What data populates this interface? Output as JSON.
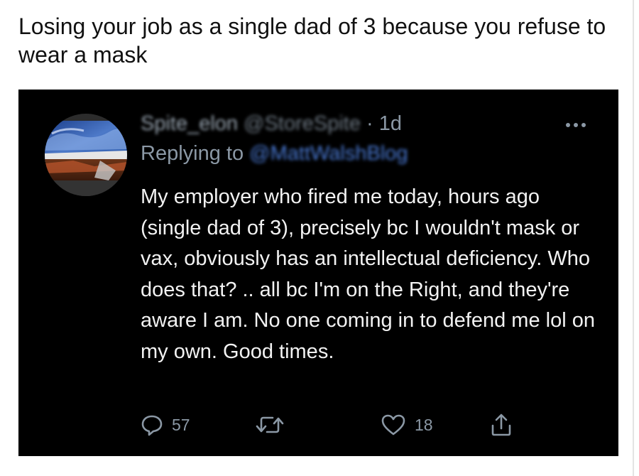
{
  "caption": "Losing your job as a single dad of 3 because you refuse to wear a mask",
  "tweet": {
    "display_name": "Spite_elon",
    "handle": "@StoreSpite",
    "time": "· 1d",
    "replying_prefix": "Replying to ",
    "replying_to": "@MattWalshBlog",
    "text": "My employer who fired me today, hours ago (single dad of 3), precisely bc I wouldn't mask or vax, obviously has an intellectual deficiency. Who does that? .. all bc I'm on the Right, and they're aware I am. No one coming in to defend me lol on my own. Good times.",
    "replies": "57",
    "likes": "18"
  },
  "icons": {
    "reply": "speech-bubble-icon",
    "retweet": "retweet-icon",
    "like": "heart-icon",
    "share": "share-icon",
    "more": "more-dots-icon"
  },
  "colors": {
    "tweet_bg": "#000000",
    "muted": "#8b98a5",
    "link": "#4b7bd6"
  }
}
